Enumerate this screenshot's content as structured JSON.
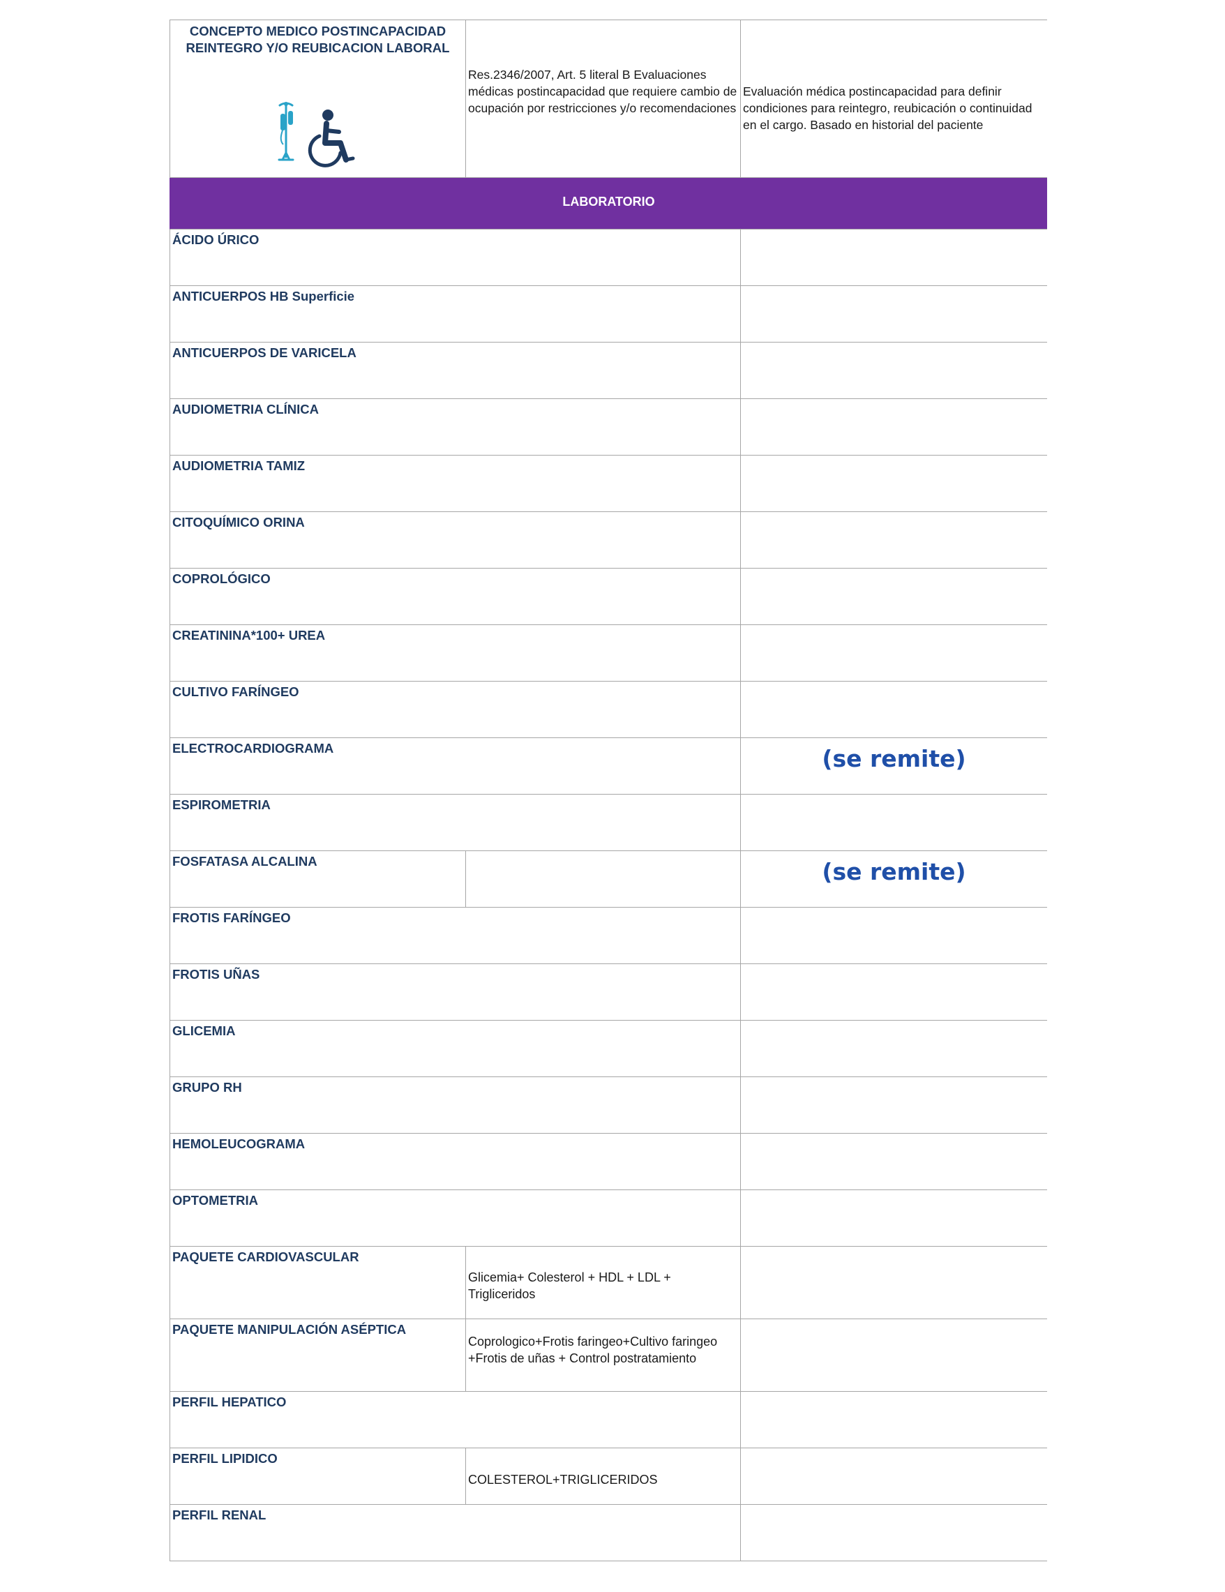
{
  "header": {
    "concept_title": "CONCEPTO MEDICO POSTINCAPACIDAD REINTEGRO Y/O REUBICACION LABORAL",
    "icons": [
      "iv-drip-stand-icon",
      "wheelchair-user-icon"
    ],
    "regulation_text": "Res.2346/2007, Art. 5 literal B Evaluaciones médicas postincapacidad que requiere cambio de ocupación por restricciones y/o recomendaciones",
    "description_text": "Evaluación médica postincapacidad para definir condiciones para reintegro, reubicación o continuidad en el cargo. Basado en historial del paciente"
  },
  "section": {
    "title": "LABORATORIO",
    "color": "#7030a0"
  },
  "colors": {
    "label_text": "#1f3a5f",
    "remite_text": "#1f4fa8",
    "grid": "#a6a6a6"
  },
  "lab_rows": [
    {
      "name": "ÁCIDO ÚRICO",
      "detail": "",
      "status": ""
    },
    {
      "name": "ANTICUERPOS HB Superficie",
      "detail": "",
      "status": ""
    },
    {
      "name": "ANTICUERPOS DE VARICELA",
      "detail": "",
      "status": ""
    },
    {
      "name": "AUDIOMETRIA CLÍNICA",
      "detail": "",
      "status": ""
    },
    {
      "name": "AUDIOMETRIA TAMIZ",
      "detail": "",
      "status": ""
    },
    {
      "name": "CITOQUÍMICO ORINA",
      "detail": "",
      "status": ""
    },
    {
      "name": "COPROLÓGICO",
      "detail": "",
      "status": ""
    },
    {
      "name": "CREATININA*100+ UREA",
      "detail": "",
      "status": ""
    },
    {
      "name": "CULTIVO FARÍNGEO",
      "detail": "",
      "status": ""
    },
    {
      "name": "ELECTROCARDIOGRAMA",
      "detail": "",
      "status": "(se remite)"
    },
    {
      "name": "ESPIROMETRIA",
      "detail": "",
      "status": ""
    },
    {
      "name": "FOSFATASA  ALCALINA",
      "detail": "",
      "status": "(se remite)"
    },
    {
      "name": "FROTIS FARÍNGEO",
      "detail": "",
      "status": ""
    },
    {
      "name": "FROTIS UÑAS",
      "detail": "",
      "status": ""
    },
    {
      "name": "GLICEMIA",
      "detail": "",
      "status": ""
    },
    {
      "name": "GRUPO RH",
      "detail": "",
      "status": ""
    },
    {
      "name": "HEMOLEUCOGRAMA",
      "detail": "",
      "status": ""
    },
    {
      "name": "OPTOMETRIA",
      "detail": "",
      "status": ""
    },
    {
      "name": "PAQUETE CARDIOVASCULAR",
      "detail": "Glicemia+ Colesterol + HDL + LDL + Trigliceridos",
      "status": ""
    },
    {
      "name": "PAQUETE MANIPULACIÓN ASÉPTICA",
      "detail": "Coprologico+Frotis faringeo+Cultivo faringeo +Frotis de uñas + Control postratamiento",
      "status": ""
    },
    {
      "name": "PERFIL HEPATICO",
      "detail": "",
      "status": ""
    },
    {
      "name": "PERFIL LIPIDICO",
      "detail": "COLESTEROL+TRIGLICERIDOS",
      "status": ""
    },
    {
      "name": "PERFIL RENAL",
      "detail": "",
      "status": ""
    }
  ]
}
